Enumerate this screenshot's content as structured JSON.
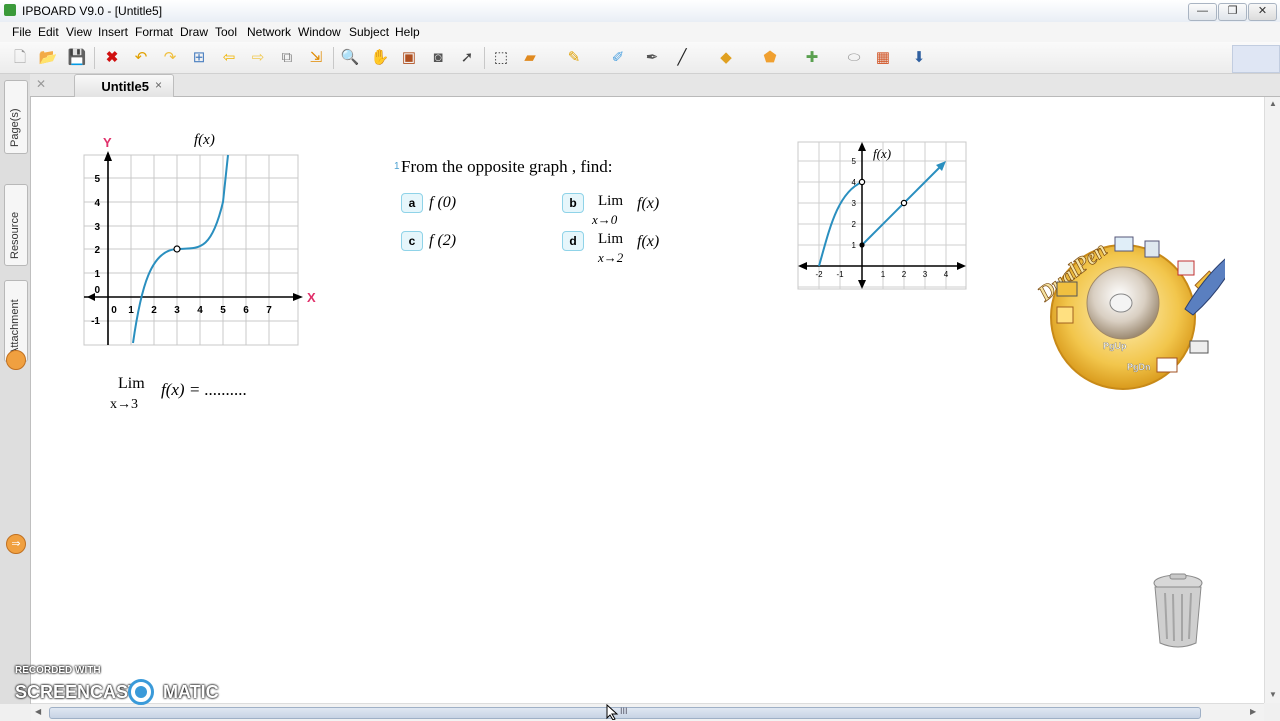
{
  "window": {
    "title": "IPBOARD V9.0 - [Untitle5]",
    "minimize": "—",
    "restore": "❐",
    "close": "✕"
  },
  "menu": [
    "File",
    "Edit",
    "View",
    "Insert",
    "Format",
    "Draw",
    "Tool",
    "Network",
    "Window",
    "Subject",
    "Help"
  ],
  "toolbar": {
    "icons": [
      "new-file-icon",
      "open-folder-icon",
      "save-icon",
      "delete-icon",
      "undo-icon",
      "redo-icon",
      "select-icon",
      "previous-page-icon",
      "next-page-icon",
      "copy-page-icon",
      "export-icon",
      "zoom-icon",
      "pan-hand-icon",
      "image-icon",
      "camera-icon",
      "cursor-icon",
      "select-region-icon",
      "eraser-icon",
      "pen-icon",
      "highlighter-icon",
      "magic-pen-icon",
      "line-icon",
      "shape-icon",
      "fill-icon",
      "tools-icon",
      "mouse-icon",
      "grid-icon",
      "arrow-down-icon"
    ]
  },
  "tab": {
    "label": "Untitle5",
    "close": "×"
  },
  "side_tabs": [
    "Page(s)",
    "Resource",
    "Attachment"
  ],
  "graph_left": {
    "y_axis": "Y",
    "x_axis": "X",
    "func_label": "f(x)",
    "y_ticks": [
      "5",
      "4",
      "3",
      "2",
      "1",
      "0",
      "-1"
    ],
    "x_ticks": [
      "0",
      "1",
      "2",
      "3",
      "4",
      "5",
      "6",
      "7"
    ]
  },
  "limit_left": {
    "lim": "Lim",
    "approach": "x→3",
    "expr": "f(x) = .........."
  },
  "question": {
    "number": "1",
    "prompt": "From the opposite graph , find:",
    "items": [
      {
        "badge": "a",
        "text": "f (0)"
      },
      {
        "badge": "b",
        "lim": "Lim",
        "approach": "x→0",
        "func": "f(x)"
      },
      {
        "badge": "c",
        "text": "f (2)"
      },
      {
        "badge": "d",
        "lim": "Lim",
        "approach": "x→2",
        "func": "f(x)"
      }
    ]
  },
  "graph_right": {
    "func_label": "f(x)",
    "y_ticks": [
      "5",
      "4",
      "3",
      "2",
      "1"
    ],
    "x_ticks": [
      "-2",
      "-1",
      "1",
      "2",
      "3",
      "4"
    ]
  },
  "dualpen": {
    "brand": "DualPen",
    "labels": [
      "PgUp",
      "PgDn"
    ]
  },
  "watermark": {
    "line1": "RECORDED WITH",
    "line2a": "SCREENCAST",
    "line2b": "MATIC"
  },
  "scroll_grip": "III"
}
